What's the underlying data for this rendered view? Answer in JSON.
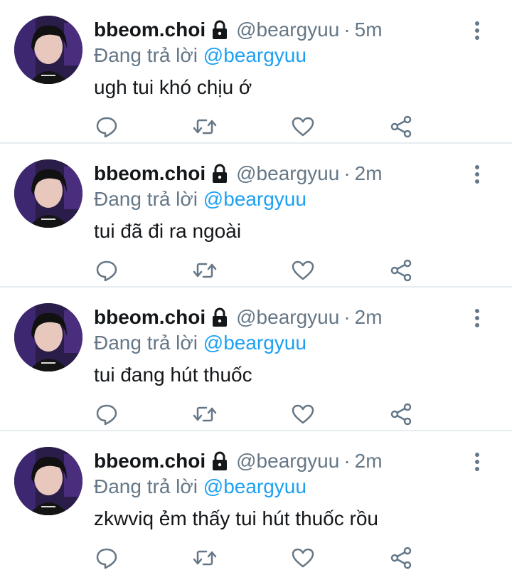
{
  "colors": {
    "accent": "#1da1f2",
    "muted": "#657786",
    "text": "#14171a",
    "divider": "#e6ecf0"
  },
  "tweets": [
    {
      "display_name": "bbeom.choi",
      "handle": "@beargyuu",
      "separator": "·",
      "time": "5m",
      "reply_prefix": "Đang trả lời",
      "reply_to": "@beargyuu",
      "text": "ugh tui khó chịu ớ"
    },
    {
      "display_name": "bbeom.choi",
      "handle": "@beargyuu",
      "separator": "·",
      "time": "2m",
      "reply_prefix": "Đang trả lời",
      "reply_to": "@beargyuu",
      "text": "tui đã đi ra ngoài"
    },
    {
      "display_name": "bbeom.choi",
      "handle": "@beargyuu",
      "separator": "·",
      "time": "2m",
      "reply_prefix": "Đang trả lời",
      "reply_to": "@beargyuu",
      "text": "tui đang hút thuốc"
    },
    {
      "display_name": "bbeom.choi",
      "handle": "@beargyuu",
      "separator": "·",
      "time": "2m",
      "reply_prefix": "Đang trả lời",
      "reply_to": "@beargyuu",
      "text": "zkwviq ẻm thấy tui hút thuốc rồu"
    }
  ],
  "icons": {
    "lock": "lock-icon",
    "more": "more-vertical-icon",
    "reply": "reply-icon",
    "retweet": "retweet-icon",
    "like": "heart-icon",
    "share": "share-icon"
  }
}
